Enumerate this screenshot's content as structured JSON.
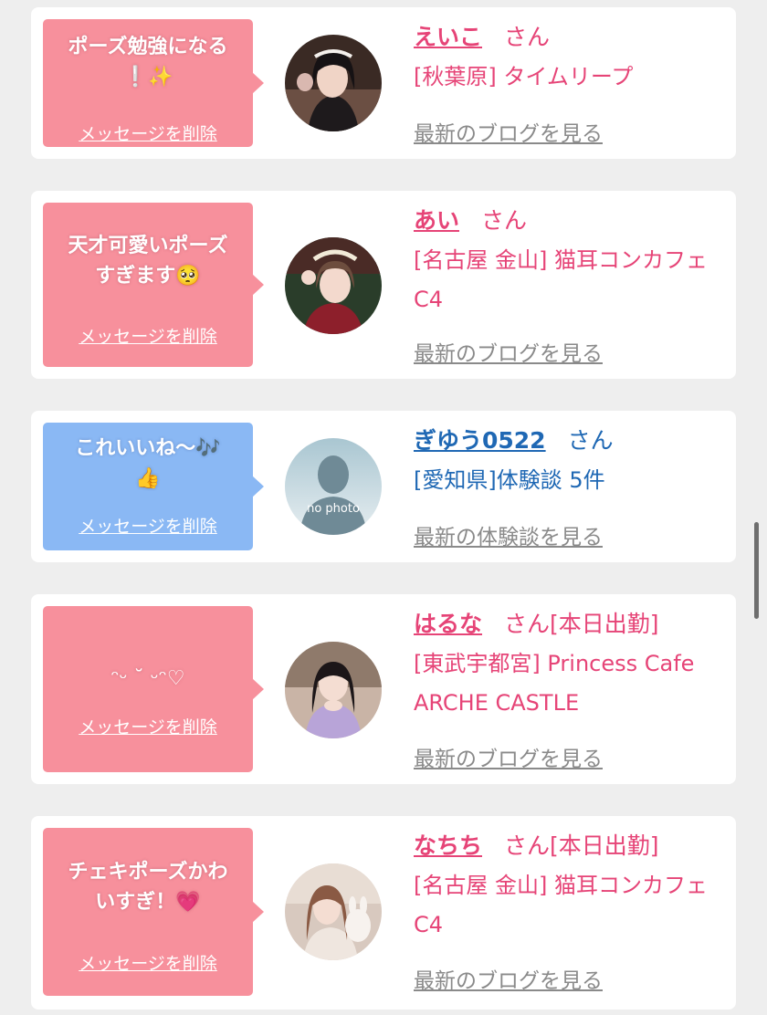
{
  "cards": [
    {
      "message": "ポーズ勉強になる\n❕✨",
      "delete_label": "メッセージを削除",
      "name": "えいこ",
      "honorific": "さん",
      "status": "",
      "shop": "[秋葉原] タイムリープ",
      "link_label": "最新のブログを見る",
      "theme": "pink"
    },
    {
      "message": "天才可愛いポーズ\nすぎます🥺",
      "delete_label": "メッセージを削除",
      "name": "あい",
      "honorific": "さん",
      "status": "",
      "shop": "[名古屋 金山] 猫耳コンカフェ C4",
      "link_label": "最新のブログを見る",
      "theme": "pink"
    },
    {
      "message": "これいいね〜🎶\n👍",
      "delete_label": "メッセージを削除",
      "name": "ぎゆう0522",
      "honorific": "さん",
      "status": "",
      "shop": "[愛知県]体験談 5件",
      "link_label": "最新の体験談を見る",
      "theme": "blue",
      "avatar_text": "no photo"
    },
    {
      "message": "ᵔᵕ ˘ ᵕᵔ♡",
      "delete_label": "メッセージを削除",
      "name": "はるな",
      "honorific": "さん",
      "status": "[本日出勤]",
      "shop": "[東武宇都宮] Princess Cafe ARCHE CASTLE",
      "link_label": "最新のブログを見る",
      "theme": "pink"
    },
    {
      "message": "チェキポーズかわ\nいすぎ！💗",
      "delete_label": "メッセージを削除",
      "name": "なちち",
      "honorific": "さん",
      "status": "[本日出勤]",
      "shop": "[名古屋 金山] 猫耳コンカフェ C4",
      "link_label": "最新のブログを見る",
      "theme": "pink"
    }
  ],
  "colors": {
    "pink_bubble": "#f7909c",
    "blue_bubble": "#8ab8f4",
    "pink_text": "#e64477",
    "blue_text": "#1f68b4",
    "link_gray": "#8a8a8a",
    "background": "#eeeeee"
  }
}
